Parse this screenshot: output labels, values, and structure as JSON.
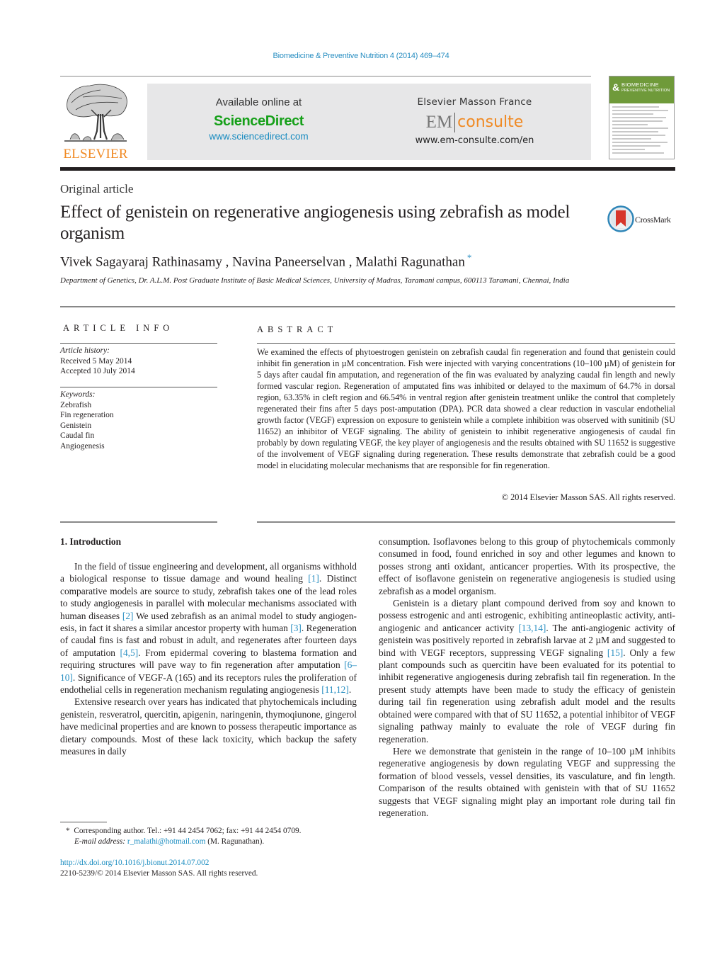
{
  "journal_ref": "Biomedicine & Preventive Nutrition 4 (2014) 469–474",
  "publisher_logo": {
    "icon": "elsevier-tree-icon",
    "wordmark": "ELSEVIER"
  },
  "banner": {
    "sciencedirect": {
      "available_label": "Available online at",
      "brand": "ScienceDirect",
      "url": "www.sciencedirect.com"
    },
    "emconsulte": {
      "publisher": "Elsevier Masson France",
      "logo_left": "EM",
      "logo_right": "consulte",
      "url": "www.em-consulte.com/en"
    }
  },
  "journal_cover": {
    "amp": "&",
    "title_line1": "BIOMEDICINE",
    "title_line2": "PREVENTIVE NUTRITION"
  },
  "crossmark": {
    "icon": "crossmark-icon",
    "label": "CrossMark"
  },
  "article": {
    "type": "Original article",
    "title": "Effect of genistein on regenerative angiogenesis using zebrafish as model organism",
    "authors": [
      "Vivek Sagayaraj Rathinasamy",
      "Navina Paneerselvan",
      "Malathi Ragunathan"
    ],
    "author_separator": " , ",
    "corresponding_marker": "*",
    "affiliation": "Department of Genetics, Dr. A.L.M. Post Graduate Institute of Basic Medical Sciences, University of Madras, Taramani campus, 600113 Taramani, Chennai, India"
  },
  "article_info": {
    "heading": "ARTICLE INFO",
    "history_label": "Article history:",
    "received": "Received 5 May 2014",
    "accepted": "Accepted 10 July 2014",
    "keywords_label": "Keywords:",
    "keywords": [
      "Zebrafish",
      "Fin regeneration",
      "Genistein",
      "Caudal fin",
      "Angiogenesis"
    ]
  },
  "abstract": {
    "heading": "ABSTRACT",
    "text": "We examined the effects of phytoestrogen genistein on zebrafish caudal fin regeneration and found that genistein could inhibit fin generation in µM concentration. Fish were injected with varying concentra­tions (10–100 µM) of genistein for 5 days after caudal fin amputation, and regeneration of the fin was evaluated by analyzing caudal fin length and newly formed vascular region. Regeneration of amputated fins was inhibited or delayed to the maximum of 64.7% in dorsal region, 63.35% in cleft region and 66.54% in ventral region after genistein treatment unlike the control that completely regenerated their fins after 5 days post-amputation (DPA). PCR data showed a clear reduction in vascular endothelial growth factor (VEGF) expression on exposure to genistein while a complete inhibition was observed with sunitinib (SU 11652) an inhibitor of VEGF signaling. The ability of genistein to inhibit regenerative angiogenesis of cau­dal fin probably by down regulating VEGF, the key player of angiogenesis and the results obtained with SU 11652 is suggestive of the involvement of VEGF signaling during regeneration. These results demon­strate that zebrafish could be a good model in elucidating molecular mechanisms that are responsible for fin regeneration.",
    "copyright": "© 2014 Elsevier Masson SAS. All rights reserved."
  },
  "introduction": {
    "heading": "1.  Introduction",
    "p1": [
      {
        "t": "In the field of tissue engineering and development, all organ­isms withhold a biological response to tissue damage and wound healing "
      },
      {
        "c": "[1]"
      },
      {
        "t": ". Distinct comparative models are source to study, zebrafish takes one of the lead roles to study angiogenesis in paral­lel with molecular mechanisms associated with human diseases "
      },
      {
        "c": "[2]"
      },
      {
        "t": " We used zebrafish as an animal model to study angiogen­esis, in fact it shares a similar ancestor property with human "
      },
      {
        "c": "[3]"
      },
      {
        "t": ". Regeneration of caudal fins is fast and robust in adult, and regenerates after fourteen days of amputation "
      },
      {
        "c": "[4,5]"
      },
      {
        "t": ". From epi­dermal covering to blastema formation and requiring structures will pave way to fin regeneration after amputation "
      },
      {
        "c": "[6–10]"
      },
      {
        "t": ". Signif­icance of VEGF-A (165) and its receptors rules the proliferation of endothelial cells in regeneration mechanism regulating angiogen­esis "
      },
      {
        "c": "[11,12]"
      },
      {
        "t": "."
      }
    ],
    "p2_left": "Extensive research over years has indicated that phytochemicals including genistein, resveratrol, quercitin, apigenin, naringenin, thymoqiunone, gingerol have medicinal properties and are known to possess therapeutic importance as dietary compounds. Most of these lack toxicity, which backup the safety measures in daily",
    "p2_right": "consumption. Isoflavones belong to this group of phytochemicals commonly consumed in food, found enriched in soy and other legumes and known to posses strong anti oxidant, anticancer prop­erties. With its prospective, the effect of isoflavone genistein on regenerative angiogenesis is studied using zebrafish as a model organism.",
    "p3": [
      {
        "t": "Genistein is a dietary plant compound derived from soy and known to possess estrogenic and anti estrogenic, exhibiting anti­neoplastic activity, anti-angiogenic and anticancer activity "
      },
      {
        "c": "[13,14]"
      },
      {
        "t": ". The anti-angiogenic activity of genistein was positively reported in zebrafish larvae at 2 µM and suggested to bind with VEGF recep­tors, suppressing VEGF signaling "
      },
      {
        "c": "[15]"
      },
      {
        "t": ". Only a few plant compounds such as quercitin have been evaluated for its potential to inhibit regenerative angiogenesis during zebrafish tail fin regeneration. In the present study attempts have been made to study the efficacy of genistein during tail fin regeneration using zebrafish adult model and the results obtained were compared with that of SU 11652, a potential inhibitor of VEGF signaling pathway mainly to evaluate the role of VEGF during fin regeneration."
      }
    ],
    "p4": "Here we demonstrate that genistein in the range of 10–100 µM inhibits regenerative angiogenesis by down regulating VEGF and suppressing the formation of blood vessels, vessel densities, its vas­culature, and fin length. Comparison of the results obtained with genistein with that of SU 11652 suggests that VEGF signaling might play an important role during tail fin regeneration."
  },
  "footnote": {
    "marker": "*",
    "corresponding": "Corresponding author. Tel.: +91 44 2454 7062; fax: +91 44 2454 0709.",
    "email_label": "E-mail address:",
    "email": "r_malathi@hotmail.com",
    "email_suffix": " (M. Ragunathan)."
  },
  "doi": {
    "url": "http://dx.doi.org/10.1016/j.bionut.2014.07.002",
    "issn_line": "2210-5239/© 2014 Elsevier Masson SAS. All rights reserved."
  },
  "colors": {
    "link": "#2a8fc2",
    "sciencedirect_green": "#16a019",
    "elsevier_orange": "#f08a24",
    "banner_gray": "#e7e7e8",
    "cover_green": "#6f9a3a"
  }
}
